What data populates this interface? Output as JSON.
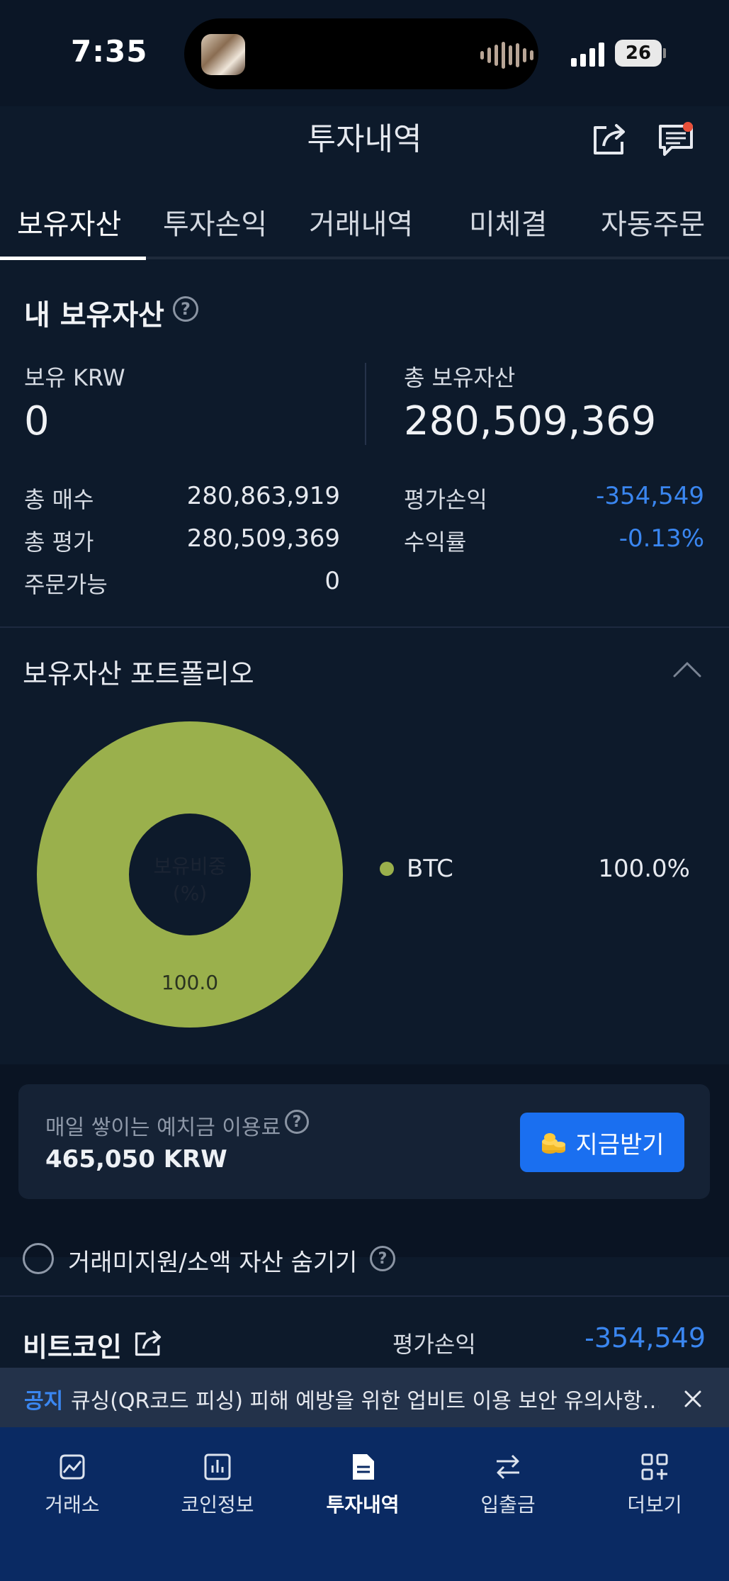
{
  "status_bar": {
    "time": "7:35",
    "battery": "26"
  },
  "header": {
    "title": "투자내역"
  },
  "tabs": [
    {
      "label": "보유자산",
      "active": true
    },
    {
      "label": "투자손익",
      "active": false
    },
    {
      "label": "거래내역",
      "active": false
    },
    {
      "label": "미체결",
      "active": false
    },
    {
      "label": "자동주문",
      "active": false
    }
  ],
  "summary": {
    "title": "내 보유자산",
    "help_icon": "?",
    "krw_label": "보유 KRW",
    "krw_value": "0",
    "total_assets_label": "총 보유자산",
    "total_assets_value": "280,509,369",
    "rows_left": [
      {
        "label": "총 매수",
        "value": "280,863,919"
      },
      {
        "label": "총 평가",
        "value": "280,509,369"
      },
      {
        "label": "주문가능",
        "value": "0"
      }
    ],
    "rows_right": [
      {
        "label": "평가손익",
        "value": "-354,549"
      },
      {
        "label": "수익률",
        "value": "-0.13%"
      }
    ]
  },
  "portfolio": {
    "title": "보유자산 포트폴리오",
    "center_label_1": "보유비중",
    "center_label_2": "(%)",
    "slice_label": "100.0",
    "legend": [
      {
        "name": "BTC",
        "value": "100.0%",
        "color": "#9ab04c"
      }
    ]
  },
  "chart_data": {
    "type": "pie",
    "categories": [
      "BTC"
    ],
    "values": [
      100.0
    ],
    "colors": [
      "#9ab04c"
    ]
  },
  "fee_card": {
    "label": "매일 쌓이는 예치금 이용료",
    "help_icon": "?",
    "value": "465,050 KRW",
    "button_label": "지금받기"
  },
  "hide_toggle": {
    "label": "거래미지원/소액 자산 숨기기",
    "help_icon": "?"
  },
  "coin_row": {
    "name": "비트코인",
    "pl_label": "평가손익",
    "pl_value": "-354,549"
  },
  "notice": {
    "tag": "공지",
    "text": "큐싱(QR코드 피싱) 피해 예방을 위한 업비트 이용 보안 유의사항…"
  },
  "bottom_nav": [
    {
      "label": "거래소",
      "icon": "chart-trend-icon",
      "active": false
    },
    {
      "label": "코인정보",
      "icon": "bar-chart-icon",
      "active": false
    },
    {
      "label": "투자내역",
      "icon": "document-icon",
      "active": true
    },
    {
      "label": "입출금",
      "icon": "transfer-arrows-icon",
      "active": false
    },
    {
      "label": "더보기",
      "icon": "grid-plus-icon",
      "active": false
    }
  ],
  "colors": {
    "accent": "#1a6ff0",
    "negative": "#3a86f0",
    "btc": "#9ab04c",
    "nav_bg": "#0a2a63"
  }
}
